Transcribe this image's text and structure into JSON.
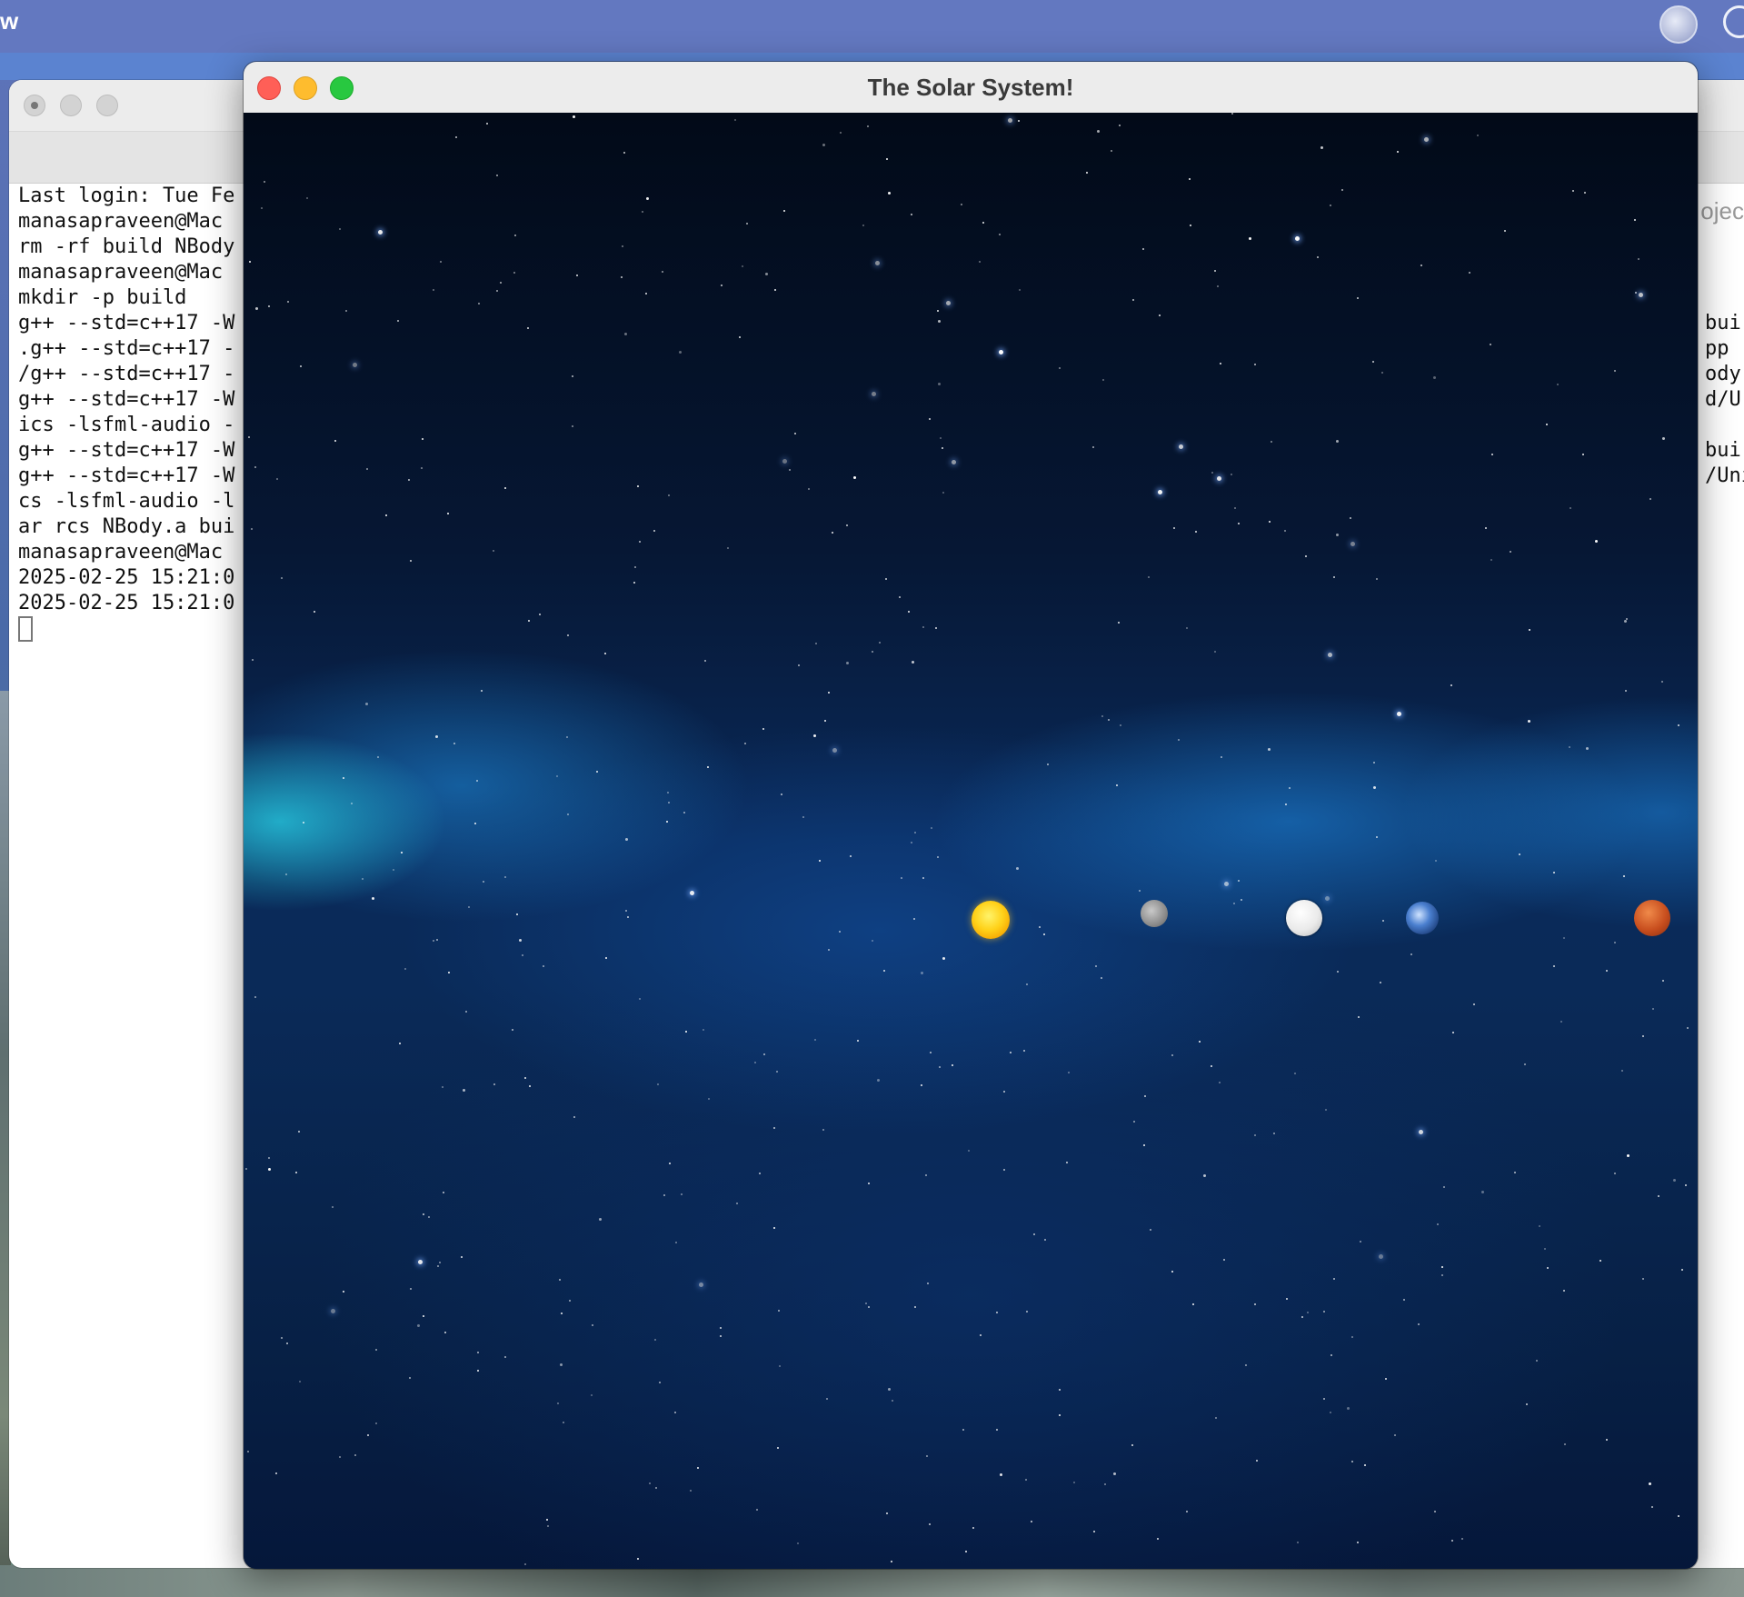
{
  "desktop": {
    "menu_fragment": "w",
    "colors": {
      "top_strip": "#6378c0",
      "accent_blue": "#5b83d0"
    }
  },
  "terminal": {
    "tab_label_fragment": "ojec",
    "lines": [
      "Last login: Tue Fe",
      "manasapraveen@Mac",
      "rm -rf build NBody",
      "manasapraveen@Mac",
      "mkdir -p build",
      "g++ --std=c++17 -W",
      ".g++ --std=c++17 -",
      "/g++ --std=c++17 -",
      "g++ --std=c++17 -W",
      "ics -lsfml-audio -",
      "g++ --std=c++17 -W",
      "g++ --std=c++17 -W",
      "cs -lsfml-audio -l",
      "ar rcs NBody.a bui",
      "manasapraveen@Mac",
      "2025-02-25 15:21:0",
      "2025-02-25 15:21:0"
    ],
    "right_fragments": [
      "",
      "",
      "",
      "",
      "",
      "bui",
      "pp -",
      "ody.",
      "d/Ur",
      "",
      "bui",
      "/Uni",
      "",
      "",
      "",
      "",
      ""
    ]
  },
  "solar_window": {
    "title": "The Solar System!",
    "bodies": [
      {
        "name": "sun",
        "icon": "sun"
      },
      {
        "name": "mercury",
        "icon": "mercury"
      },
      {
        "name": "venus",
        "icon": "venus"
      },
      {
        "name": "earth",
        "icon": "earth"
      },
      {
        "name": "mars",
        "icon": "mars"
      }
    ],
    "colors": {
      "close": "#ff5f57",
      "minimize": "#febc2e",
      "maximize": "#28c840"
    }
  }
}
